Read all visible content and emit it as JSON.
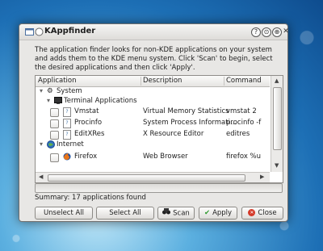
{
  "window": {
    "title": "KAppfinder",
    "buttons": {
      "help": "?",
      "minimize": "⊙",
      "maximize": "⊕",
      "close": "✕"
    }
  },
  "description": "The application finder looks for non-KDE applications on your system and adds them to the KDE menu system. Click 'Scan' to begin, select the desired applications and then click 'Apply'.",
  "columns": [
    "Application",
    "Description",
    "Command"
  ],
  "tree": [
    {
      "label": "System",
      "icon": "system-gear-icon"
    },
    {
      "label": "Terminal Applications",
      "icon": "terminal-icon"
    },
    {
      "label": "Vmstat",
      "description": "Virtual Memory Statistics",
      "command": "vmstat 2"
    },
    {
      "label": "Procinfo",
      "description": "System Process Informati...",
      "command": "procinfo -f"
    },
    {
      "label": "EditXRes",
      "description": "X Resource Editor",
      "command": "editres"
    },
    {
      "label": "Internet",
      "icon": "globe-icon"
    },
    {
      "label": "Firefox",
      "description": "Web Browser",
      "command": "firefox %u"
    }
  ],
  "summary": "Summary: 17 applications found",
  "actions": {
    "unselect_all": "Unselect All",
    "select_all": "Select All",
    "scan": "Scan",
    "apply": "Apply",
    "close": "Close"
  },
  "colors": {
    "apply_green": "#2f9a2f",
    "close_red": "#d43a2a",
    "link_blue": "#2d6ab5"
  }
}
